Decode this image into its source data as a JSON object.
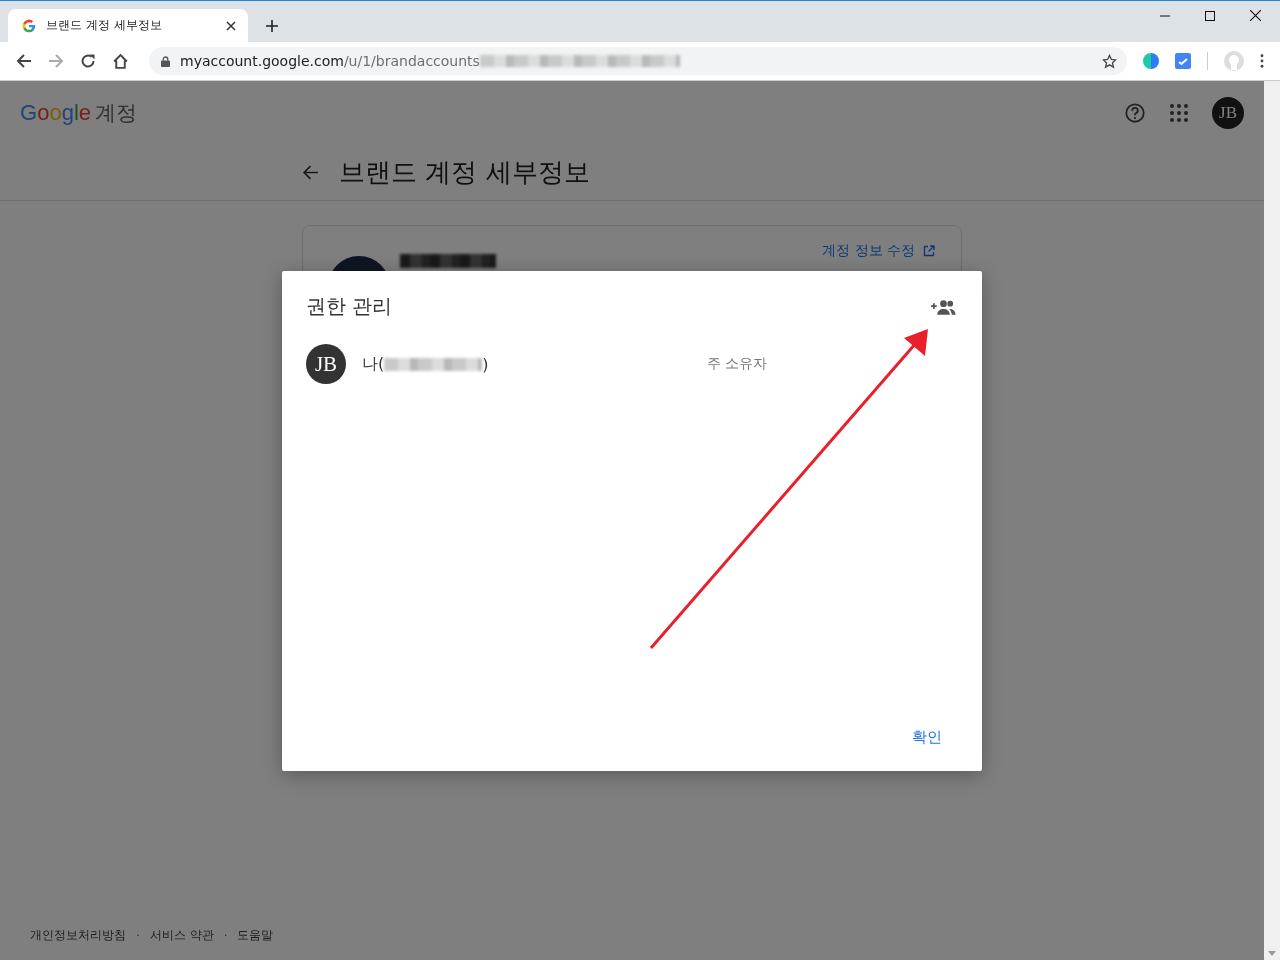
{
  "browser": {
    "tab": {
      "title": "브랜드 계정 세부정보"
    },
    "address": {
      "host": "myaccount.google.com",
      "path": "/u/1/brandaccounts"
    }
  },
  "header": {
    "logo": "Google",
    "product": "계정",
    "avatar": "JB"
  },
  "page": {
    "title": "브랜드 계정 세부정보",
    "card": {
      "edit_link": "계정 정보 수정"
    }
  },
  "dialog": {
    "title": "권한 관리",
    "members": [
      {
        "avatar": "JB",
        "name_start": "나(",
        "name_end": ")",
        "role": "주 소유자"
      }
    ],
    "confirm": "확인"
  },
  "footer": {
    "links": [
      "개인정보처리방침",
      "서비스 약관",
      "도움말"
    ],
    "separator": "·"
  }
}
